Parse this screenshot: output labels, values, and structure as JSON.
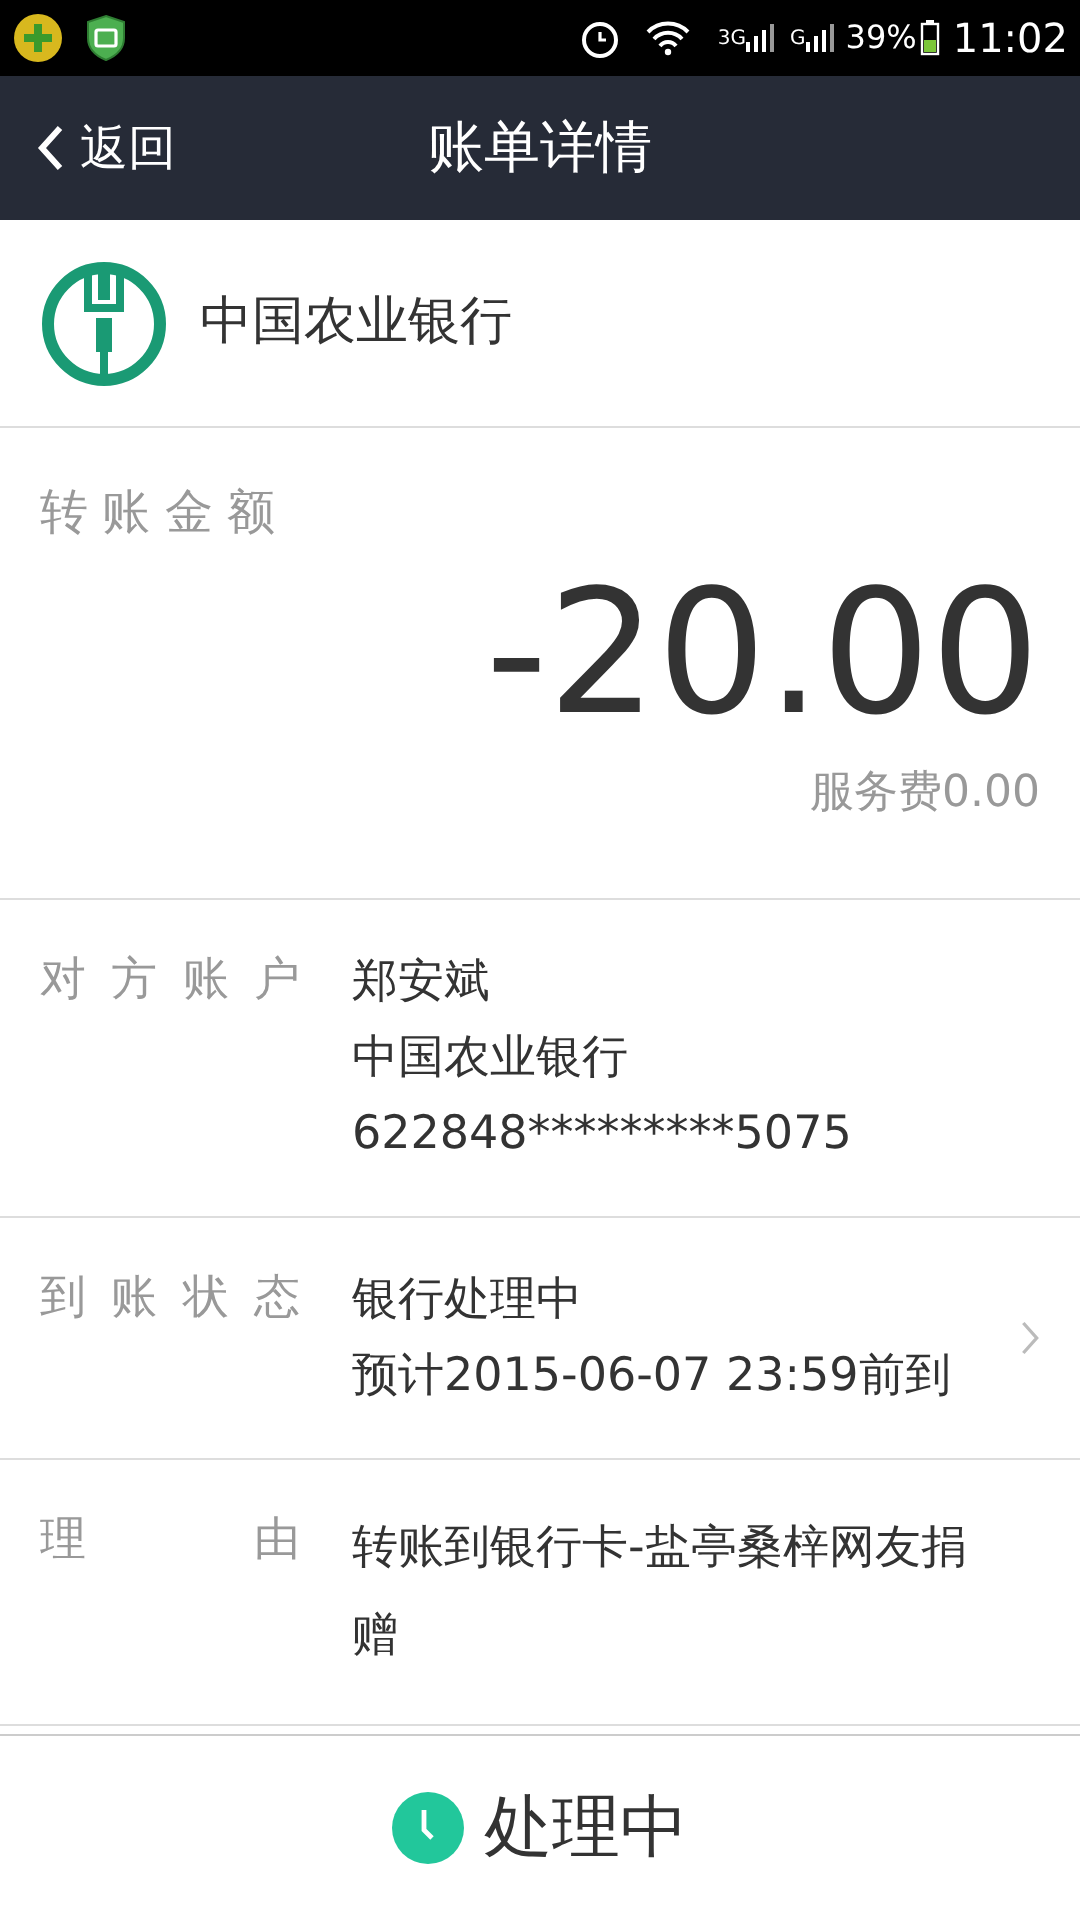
{
  "status_bar": {
    "network_1": "3G",
    "network_2": "G",
    "battery": "39%",
    "time": "11:02"
  },
  "header": {
    "back": "返回",
    "title": "账单详情"
  },
  "bank": {
    "name": "中国农业银行"
  },
  "amount": {
    "label": "转账金额",
    "value": "-20.00",
    "fee": "服务费0.00"
  },
  "details": [
    {
      "label": "对方账户",
      "lines": [
        "郑安斌",
        "中国农业银行",
        "622848*********5075"
      ],
      "has_arrow": false
    },
    {
      "label": "到账状态",
      "lines": [
        "银行处理中",
        "预计2015-06-07 23:59前到"
      ],
      "has_arrow": true
    },
    {
      "label": "理由",
      "lines": [
        "转账到银行卡-盐亭桑梓网友捐赠"
      ],
      "has_arrow": false
    }
  ],
  "footer": {
    "status": "处理中"
  }
}
